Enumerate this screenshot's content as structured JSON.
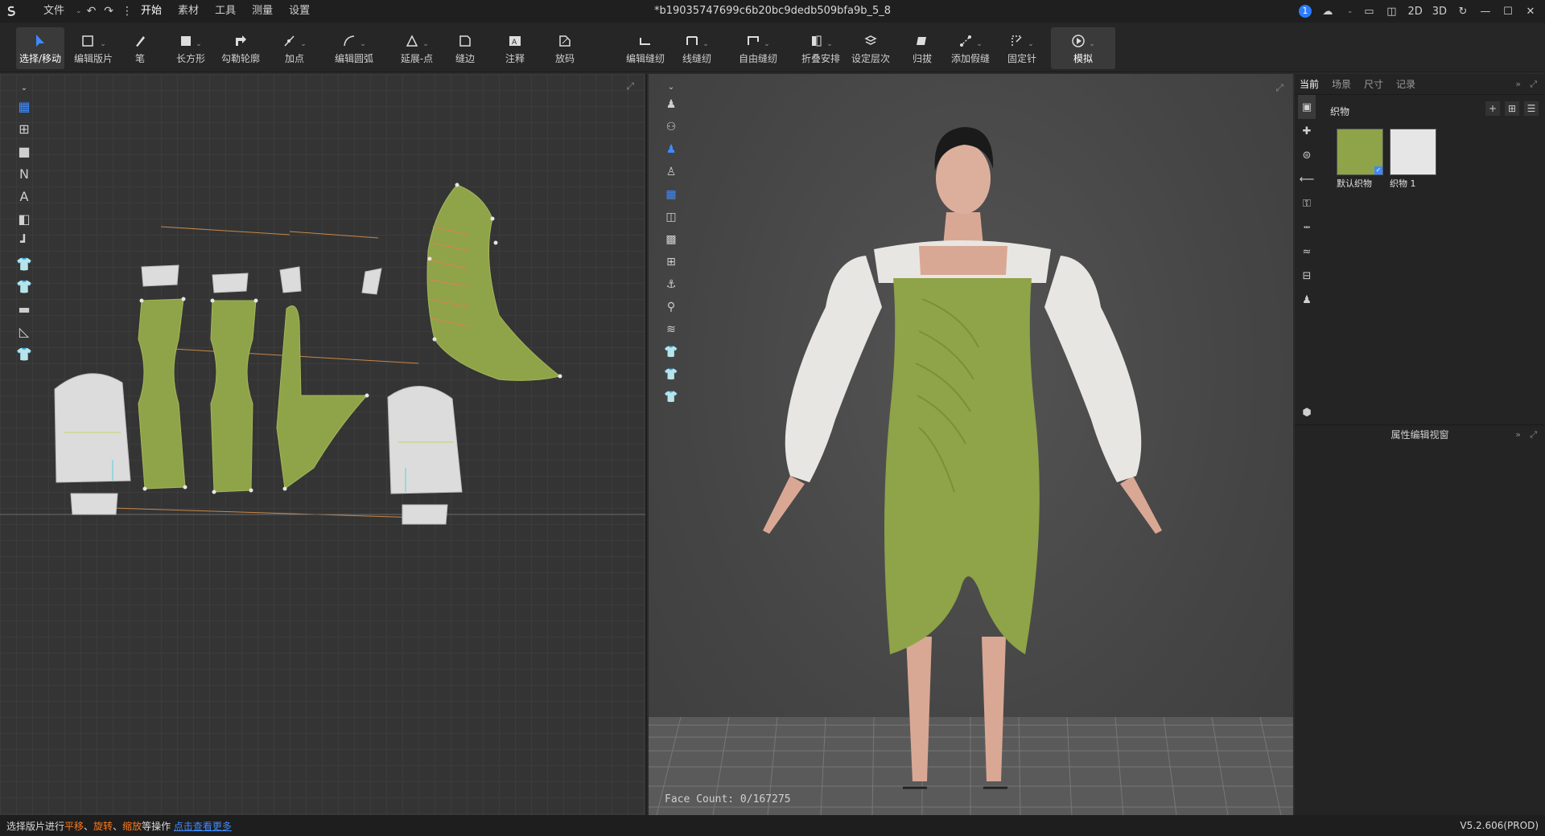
{
  "titlebar": {
    "menu": [
      "文件",
      "开始",
      "素材",
      "工具",
      "测量",
      "设置"
    ],
    "doc_title": "*b19035747699c6b20bc9dedb509bfa9b_5_8",
    "notification_count": "1",
    "view_modes": [
      "2D",
      "3D"
    ]
  },
  "toolbar": {
    "tools": [
      {
        "label": "选择/移动"
      },
      {
        "label": "编辑版片"
      },
      {
        "label": "笔"
      },
      {
        "label": "长方形"
      },
      {
        "label": "勾勒轮廓"
      },
      {
        "label": "加点"
      },
      {
        "label": "编辑圆弧"
      },
      {
        "label": "延展-点"
      },
      {
        "label": "缝边"
      },
      {
        "label": "注释"
      },
      {
        "label": "放码"
      },
      {
        "label": "编辑缝纫"
      },
      {
        "label": "线缝纫"
      },
      {
        "label": "自由缝纫"
      },
      {
        "label": "折叠安排"
      },
      {
        "label": "设定层次"
      },
      {
        "label": "归拔"
      },
      {
        "label": "添加假缝"
      },
      {
        "label": "固定针"
      },
      {
        "label": "模拟"
      }
    ]
  },
  "panel3d": {
    "face_count": "Face Count: 0/167275"
  },
  "right_panel": {
    "tabs": [
      "当前",
      "场景",
      "尺寸",
      "记录"
    ],
    "fabric_header": "织物",
    "fabrics": [
      {
        "name": "默认织物",
        "color": "#8fa348"
      },
      {
        "name": "织物 1",
        "color": "#e6e6e6"
      }
    ],
    "property_title": "属性编辑视窗"
  },
  "status": {
    "prefix": "选择版片进行",
    "op1": "平移",
    "sep1": "、",
    "op2": "旋转",
    "sep2": "、",
    "op3": "缩放",
    "suffix": "等操作 ",
    "link": "点击查看更多",
    "version": "V5.2.606(PROD)"
  },
  "colors": {
    "fabric_green": "#8fa348",
    "fabric_white": "#dcdcdc",
    "accent_blue": "#3d8bff",
    "seam_orange": "#c8884a"
  }
}
